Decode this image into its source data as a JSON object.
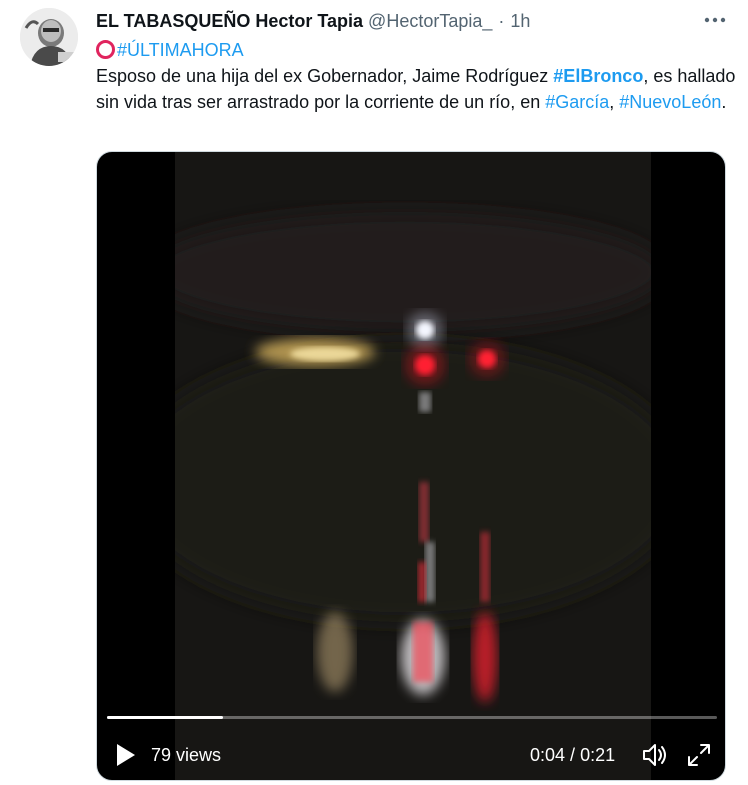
{
  "tweet": {
    "author_name": "EL TABASQUEÑO Hector Tapia",
    "handle": "@HectorTapia_",
    "separator": "·",
    "time": "1h",
    "more_icon": "more-horizontal-icon",
    "text": {
      "line1_tag": "#ÚLTIMAHORA",
      "line1_emoji": "hollow-red-circle",
      "p1": "Esposo de una hija del ex Gobernador, Jaime Rodríguez ",
      "tag_elbronco": "#ElBronco",
      "p2": ", es hallado sin vida tras ser arrastrado por la corriente de un río, en ",
      "tag_garcia": "#García",
      "p3": ", ",
      "tag_nuevoleon": "#NuevoLeón",
      "p4": "."
    }
  },
  "video": {
    "views": "79 views",
    "current_time": "0:04",
    "time_separator": " / ",
    "duration": "0:21",
    "progress": 0.19,
    "icons": {
      "play": "play-icon",
      "volume": "volume-icon",
      "fullscreen": "fullscreen-icon"
    }
  },
  "colors": {
    "link": "#1d9bf0",
    "text": "#0f1419",
    "muted": "#536471",
    "emoji_red": "#e0245e"
  }
}
